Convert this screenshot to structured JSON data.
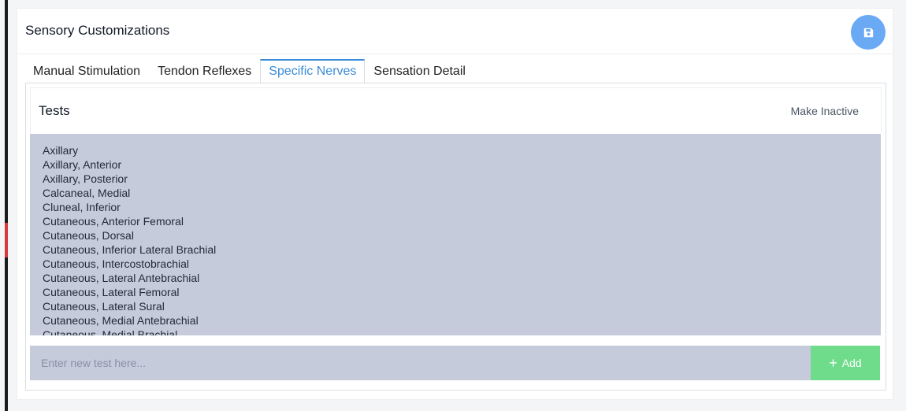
{
  "header": {
    "title": "Sensory Customizations",
    "save_icon": "floppy-disk-icon"
  },
  "tabs": [
    {
      "label": "Manual Stimulation",
      "active": false
    },
    {
      "label": "Tendon Reflexes",
      "active": false
    },
    {
      "label": "Specific Nerves",
      "active": true
    },
    {
      "label": "Sensation Detail",
      "active": false
    }
  ],
  "tests": {
    "title": "Tests",
    "make_inactive_label": "Make Inactive",
    "items": [
      "Axillary",
      "Axillary, Anterior",
      "Axillary, Posterior",
      "Calcaneal, Medial",
      "Cluneal, Inferior",
      "Cutaneous, Anterior Femoral",
      "Cutaneous, Dorsal",
      "Cutaneous, Inferior Lateral Brachial",
      "Cutaneous, Intercostobrachial",
      "Cutaneous, Lateral Antebrachial",
      "Cutaneous, Lateral Femoral",
      "Cutaneous, Lateral Sural",
      "Cutaneous, Medial Antebrachial",
      "Cutaneous, Medial Brachial"
    ]
  },
  "add_form": {
    "placeholder": "Enter new test here...",
    "value": "",
    "add_label": "Add"
  },
  "colors": {
    "accent": "#3a8bd8",
    "save_button": "#6aa9f4",
    "add_button": "#6fdc8c",
    "list_background": "#c5cbda"
  }
}
